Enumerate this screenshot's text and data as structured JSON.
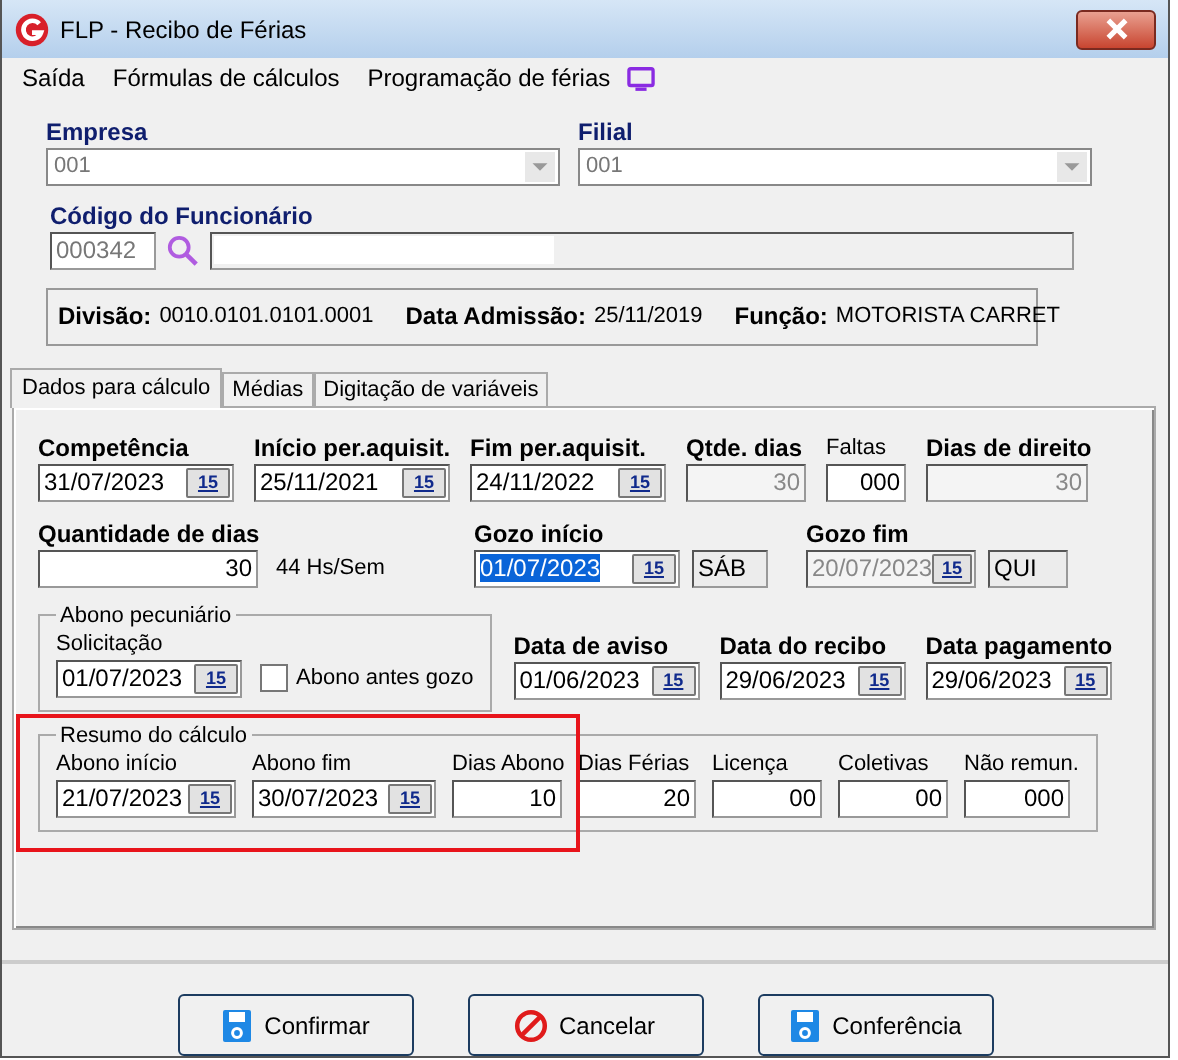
{
  "window": {
    "title": "FLP - Recibo de Férias"
  },
  "menu": [
    {
      "label": "Saída"
    },
    {
      "label": "Fórmulas de cálculos"
    },
    {
      "label": "Programação de férias"
    }
  ],
  "empresa": {
    "label": "Empresa",
    "value": "001"
  },
  "filial": {
    "label": "Filial",
    "value": "001"
  },
  "funcionario": {
    "label": "Código do Funcionário",
    "code": "000342"
  },
  "info": [
    {
      "label": "Divisão:",
      "value": "0010.0101.0101.0001"
    },
    {
      "label": "Data Admissão:",
      "value": "25/11/2019"
    },
    {
      "label": "Função:",
      "value": "MOTORISTA CARRET"
    }
  ],
  "tabs": [
    {
      "label": "Dados para cálculo",
      "selected": true
    },
    {
      "label": "Médias",
      "selected": false
    },
    {
      "label": "Digitação de variáveis",
      "selected": false
    }
  ],
  "calc": {
    "row1": [
      {
        "label": "Competência",
        "bold": true,
        "kind": "date",
        "value": "31/07/2023",
        "button": "15",
        "disabled": false
      },
      {
        "label": "Início per.aquisit.",
        "bold": true,
        "kind": "date",
        "value": "25/11/2021",
        "button": "15",
        "disabled": false
      },
      {
        "label": "Fim per.aquisit.",
        "bold": true,
        "kind": "date",
        "value": "24/11/2022",
        "button": "15",
        "disabled": false
      },
      {
        "label": "Qtde. dias",
        "bold": true,
        "kind": "number",
        "value": "30",
        "disabled": true
      },
      {
        "label": "Faltas",
        "bold": false,
        "kind": "number",
        "value": "000",
        "disabled": false
      },
      {
        "label": "Dias de direito",
        "bold": true,
        "kind": "number",
        "value": "30",
        "disabled": true
      }
    ],
    "row2": [
      {
        "label": "Quantidade de dias",
        "bold": true,
        "kind": "number",
        "value": "30",
        "disabled": false
      },
      {
        "kind": "note",
        "value": "44 Hs/Sem"
      },
      {
        "label": "Gozo início",
        "bold": true,
        "kind": "date",
        "value": "01/07/2023",
        "button": "15",
        "disabled": false,
        "highlighted": true
      },
      {
        "kind": "day",
        "value": "SÁB"
      },
      {
        "label": "Gozo fim",
        "bold": true,
        "kind": "date",
        "value": "20/07/2023",
        "button": "15",
        "disabled": true
      },
      {
        "kind": "day",
        "value": "QUI"
      }
    ],
    "abono": {
      "title": "Abono pecuniário",
      "field": {
        "label": "Solicitação",
        "bold": false,
        "kind": "date",
        "value": "01/07/2023",
        "button": "15",
        "disabled": false
      },
      "checkbox": {
        "label": "Abono antes gozo",
        "checked": false
      }
    },
    "dates": [
      {
        "label": "Data de aviso",
        "bold": true,
        "kind": "date",
        "value": "01/06/2023",
        "button": "15",
        "disabled": false
      },
      {
        "label": "Data do recibo",
        "bold": true,
        "kind": "date",
        "value": "29/06/2023",
        "button": "15",
        "disabled": false
      },
      {
        "label": "Data pagamento",
        "bold": true,
        "kind": "date",
        "value": "29/06/2023",
        "button": "15",
        "disabled": false
      }
    ],
    "resumo": {
      "title": "Resumo do cálculo",
      "fields": [
        {
          "label": "Abono início",
          "bold": false,
          "kind": "date",
          "value": "21/07/2023",
          "button": "15",
          "disabled": false
        },
        {
          "label": "Abono fim",
          "bold": false,
          "kind": "date",
          "value": "30/07/2023",
          "button": "15",
          "disabled": false
        },
        {
          "label": "Dias Abono",
          "bold": false,
          "kind": "number",
          "value": "10",
          "disabled": false
        },
        {
          "label": "Dias Férias",
          "bold": false,
          "kind": "number",
          "value": "20",
          "disabled": false
        },
        {
          "label": "Licença",
          "bold": false,
          "kind": "number",
          "value": "00",
          "disabled": false
        },
        {
          "label": "Coletivas",
          "bold": false,
          "kind": "number",
          "value": "00",
          "disabled": false
        },
        {
          "label": "Não remun.",
          "bold": false,
          "kind": "number",
          "value": "000",
          "disabled": false
        }
      ]
    }
  },
  "buttons": [
    {
      "label": "Confirmar",
      "kind": "save"
    },
    {
      "label": "Cancelar",
      "kind": "cancel"
    },
    {
      "label": "Conferência",
      "kind": "save"
    }
  ]
}
